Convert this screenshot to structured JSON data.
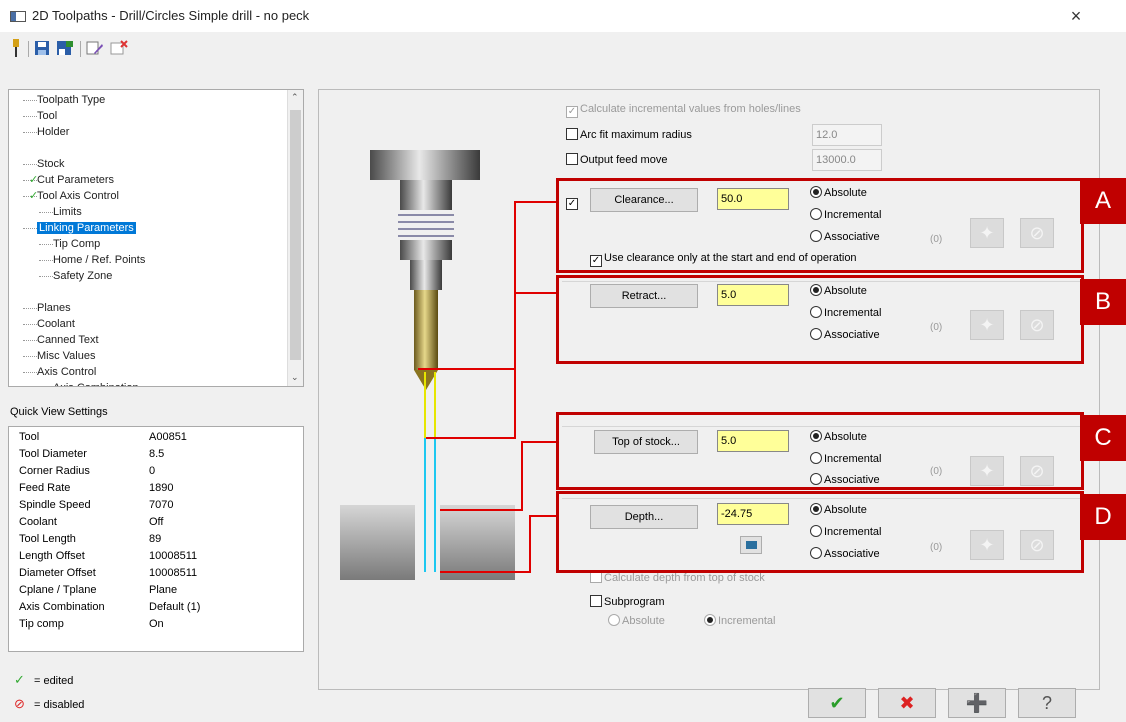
{
  "window": {
    "title": "2D Toolpaths - Drill/Circles Simple drill - no peck",
    "close": "×"
  },
  "tree": {
    "items": [
      {
        "label": "Toolpath Type"
      },
      {
        "label": "Tool"
      },
      {
        "label": "Holder"
      },
      {
        "label": "Stock"
      },
      {
        "label": "Cut Parameters",
        "edited": true
      },
      {
        "label": "Tool Axis Control",
        "edited": true
      },
      {
        "label": "Limits"
      },
      {
        "label": "Linking Parameters",
        "selected": true
      },
      {
        "label": "Tip Comp"
      },
      {
        "label": "Home / Ref. Points"
      },
      {
        "label": "Safety Zone"
      },
      {
        "label": "Planes"
      },
      {
        "label": "Coolant"
      },
      {
        "label": "Canned Text"
      },
      {
        "label": "Misc Values"
      },
      {
        "label": "Axis Control"
      },
      {
        "label": "Axis Combination"
      }
    ]
  },
  "quick_view": {
    "label": "Quick View Settings",
    "rows": [
      {
        "k": "Tool",
        "v": "A00851"
      },
      {
        "k": "Tool Diameter",
        "v": "8.5"
      },
      {
        "k": "Corner Radius",
        "v": "0"
      },
      {
        "k": "Feed Rate",
        "v": "1890"
      },
      {
        "k": "Spindle Speed",
        "v": "7070"
      },
      {
        "k": "Coolant",
        "v": "Off"
      },
      {
        "k": "Tool Length",
        "v": "89"
      },
      {
        "k": "Length Offset",
        "v": "10008511"
      },
      {
        "k": "Diameter Offset",
        "v": "10008511"
      },
      {
        "k": "Cplane / Tplane",
        "v": "Plane"
      },
      {
        "k": "Axis Combination",
        "v": "Default (1)"
      },
      {
        "k": "Tip comp",
        "v": "On"
      }
    ]
  },
  "legend": {
    "edited": "= edited",
    "disabled": "= disabled"
  },
  "options": {
    "calc_incremental": "Calculate incremental values from holes/lines",
    "arc_fit": "Arc fit maximum radius",
    "arc_fit_value": "12.0",
    "output_feed": "Output feed move",
    "output_feed_value": "13000.0"
  },
  "sections": [
    {
      "letter": "A",
      "button": "Clearance...",
      "value": "50.0",
      "selected_mode": "Absolute",
      "count": "(0)"
    },
    {
      "letter": "B",
      "button": "Retract...",
      "value": "5.0",
      "selected_mode": "Absolute",
      "count": "(0)"
    },
    {
      "letter": "C",
      "button": "Top of stock...",
      "value": "5.0",
      "selected_mode": "Absolute",
      "count": "(0)"
    },
    {
      "letter": "D",
      "button": "Depth...",
      "value": "-24.75",
      "selected_mode": "Absolute",
      "count": "(0)"
    }
  ],
  "modes": [
    "Absolute",
    "Incremental",
    "Associative"
  ],
  "clearance_only": "Use clearance only at the start and end of operation",
  "calc_depth": "Calculate depth from top of stock",
  "subprogram": {
    "label": "Subprogram",
    "absolute": "Absolute",
    "incremental": "Incremental"
  },
  "colors": {
    "accent_red": "#c00000",
    "field_yellow": "#ffff99",
    "selected_blue": "#0078d7"
  }
}
